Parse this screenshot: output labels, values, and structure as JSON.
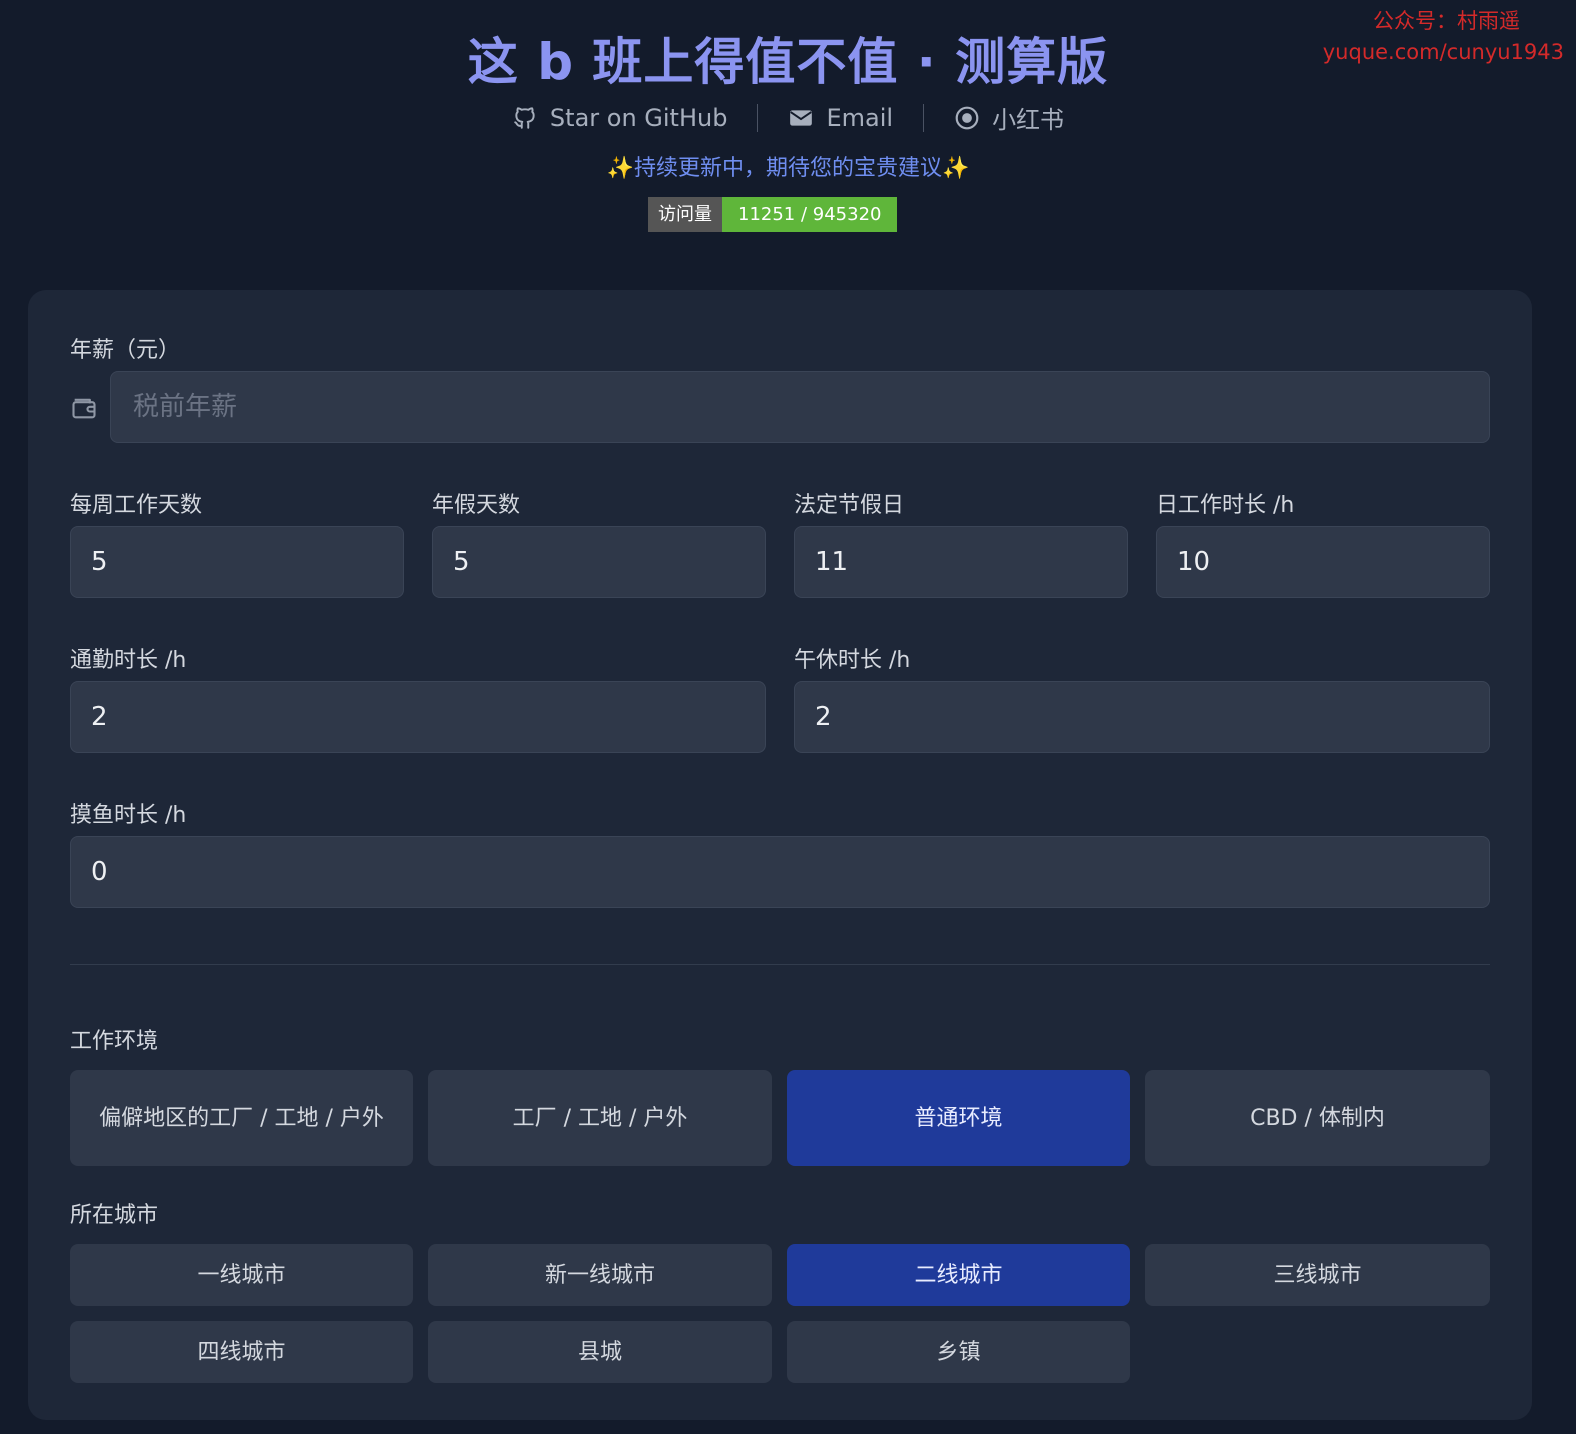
{
  "watermark": {
    "line1": "公众号：村雨遥",
    "line2": "yuque.com/cunyu1943"
  },
  "header": {
    "title": "这 b 班上得值不值 · 测算版",
    "links": [
      {
        "label": "Star on GitHub",
        "icon": "github-icon"
      },
      {
        "label": "Email",
        "icon": "mail-icon"
      },
      {
        "label": "小红书",
        "icon": "circle-dot-icon"
      }
    ],
    "tagline": "✨持续更新中，期待您的宝贵建议✨",
    "visits_label": "访问量",
    "visits_value": "11251 / 945320"
  },
  "form": {
    "salary": {
      "label": "年薪（元）",
      "placeholder": "税前年薪",
      "icon": "wallet-icon"
    },
    "work_days": {
      "label": "每周工作天数",
      "value": "5"
    },
    "annual_leave": {
      "label": "年假天数",
      "value": "5"
    },
    "holidays": {
      "label": "法定节假日",
      "value": "11"
    },
    "work_hours": {
      "label": "日工作时长 /h",
      "value": "10"
    },
    "commute": {
      "label": "通勤时长 /h",
      "value": "2"
    },
    "lunch_break": {
      "label": "午休时长 /h",
      "value": "2"
    },
    "slack": {
      "label": "摸鱼时长 /h",
      "value": "0"
    }
  },
  "environment": {
    "label": "工作环境",
    "options": [
      "偏僻地区的工厂 / 工地 / 户外",
      "工厂 / 工地 / 户外",
      "普通环境",
      "CBD / 体制内"
    ],
    "selected": "普通环境"
  },
  "city": {
    "label": "所在城市",
    "options": [
      "一线城市",
      "新一线城市",
      "二线城市",
      "三线城市",
      "四线城市",
      "县城",
      "乡镇"
    ],
    "selected": "二线城市"
  },
  "colors": {
    "accent": "#1f3a9a",
    "title": "#8b94f0",
    "tagline": "#6f8ef0",
    "badge": "#5fb63a"
  }
}
